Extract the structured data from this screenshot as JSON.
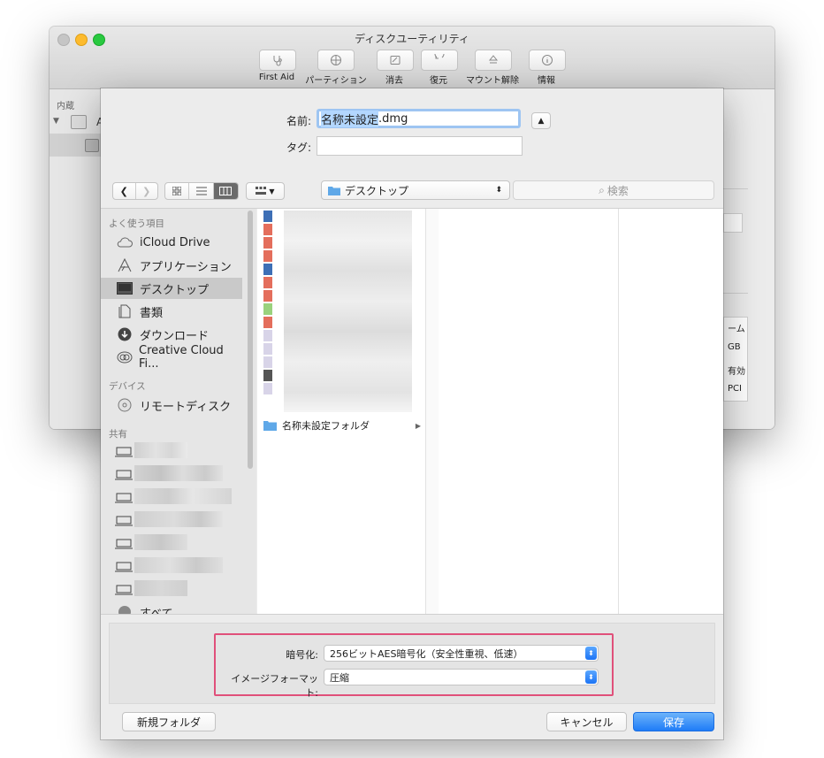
{
  "background_window": {
    "title": "ディスクユーティリティ",
    "toolbar": [
      {
        "label": "First Aid",
        "icon": "stethoscope-icon"
      },
      {
        "label": "パーティション",
        "icon": "partition-icon"
      },
      {
        "label": "消去",
        "icon": "erase-icon"
      },
      {
        "label": "復元",
        "icon": "restore-icon"
      },
      {
        "label": "マウント解除",
        "icon": "eject-icon"
      },
      {
        "label": "情報",
        "icon": "info-icon"
      }
    ],
    "sidebar_header": "内蔵",
    "sidebar_disk_letter": "A",
    "right_panel_values": [
      "ーム",
      "GB",
      "有効",
      "PCI"
    ]
  },
  "save_sheet": {
    "name_label": "名前:",
    "name_value": "名称未設定.dmg",
    "name_selected": "名称未設定",
    "name_rest": ".dmg",
    "tag_label": "タグ:",
    "location": "デスクトップ",
    "search_placeholder": "検索",
    "sidebar": {
      "favorites_header": "よく使う項目",
      "favorites": [
        {
          "label": "iCloud Drive",
          "icon": "cloud-icon"
        },
        {
          "label": "アプリケーション",
          "icon": "applications-icon"
        },
        {
          "label": "デスクトップ",
          "icon": "desktop-icon",
          "selected": true
        },
        {
          "label": "書類",
          "icon": "documents-icon"
        },
        {
          "label": "ダウンロード",
          "icon": "downloads-icon"
        },
        {
          "label": "Creative Cloud Fi...",
          "icon": "creative-cloud-icon"
        }
      ],
      "devices_header": "デバイス",
      "devices": [
        {
          "label": "リモートディスク",
          "icon": "remote-disc-icon"
        }
      ],
      "shared_header": "共有",
      "shared_count": 7,
      "all_label": "すべて..."
    },
    "folder_name": "名称未設定フォルダ",
    "encryption_label": "暗号化:",
    "encryption_value": "256ビットAES暗号化（安全性重視、低速）",
    "format_label": "イメージフォーマット:",
    "format_value": "圧縮",
    "new_folder": "新規フォルダ",
    "cancel": "キャンセル",
    "save": "保存"
  },
  "colors": {
    "accent": "#1f7cf7",
    "highlight_frame": "#e0507a",
    "selection": "#b3d7ff"
  }
}
